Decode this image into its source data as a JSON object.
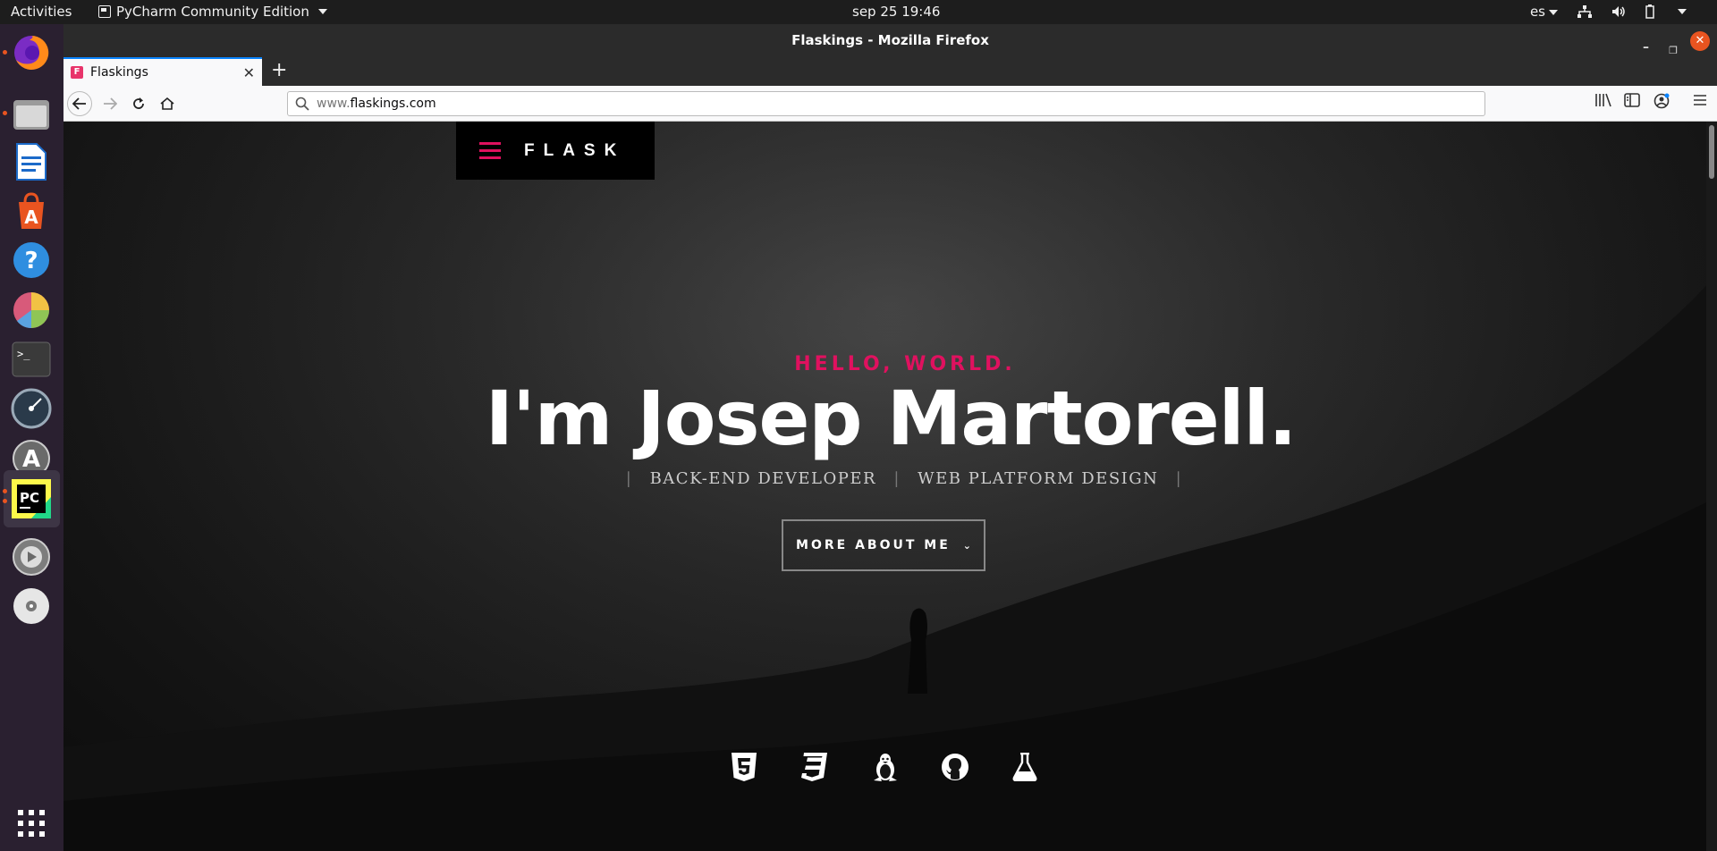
{
  "topbar": {
    "activities": "Activities",
    "app_menu": "PyCharm Community Edition",
    "clock": "sep 25  19:46",
    "lang": "es"
  },
  "dock": {
    "items": [
      "firefox-icon",
      "files-icon",
      "writer-icon",
      "software-icon",
      "help-icon",
      "chart-app-icon",
      "terminal-icon",
      "speed-gauge-icon",
      "updater-icon",
      "pycharm-icon",
      "settings-icon",
      "disc-icon",
      "app-grid-icon"
    ]
  },
  "window": {
    "title": "Flaskings - Mozilla Firefox"
  },
  "tab": {
    "favicon_letter": "F",
    "label": "Flaskings"
  },
  "urlbar": {
    "prefix": "www.",
    "domain": "flaskings.com"
  },
  "site": {
    "brand": "FLASK",
    "hello": "HELLO, WORLD.",
    "headline": "I'm Josep Martorell.",
    "roles": [
      "BACK-END DEVELOPER",
      "WEB PLATFORM DESIGN"
    ],
    "role_separator": "|",
    "more_button": "MORE ABOUT ME",
    "socials": [
      "html5-icon",
      "css3-icon",
      "linux-icon",
      "github-icon",
      "flask-icon"
    ]
  },
  "colors": {
    "accent": "#e0115f",
    "ubuntu_orange": "#e95420"
  }
}
